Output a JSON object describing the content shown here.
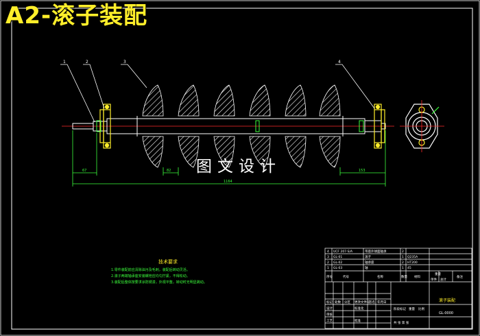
{
  "header": {
    "title": "A2-滚子装配",
    "watermark": "图文设计"
  },
  "balloons": [
    "1",
    "2",
    "3",
    "4"
  ],
  "dimensions": {
    "overall": "1164",
    "left_end": "67",
    "spacing": "82",
    "right_end": "153"
  },
  "tech_requirements": {
    "title": "技术要求",
    "items": [
      "1.零件装配前应清除油污及毛刺，装配后转动灵活。",
      "2.滚子两端轴承座安装螺栓应均匀拧紧，不得松动。",
      "3.装配后整体按要求涂防锈漆，外观平整，转动时无明显跳动。"
    ]
  },
  "parts_list": {
    "rows": [
      {
        "no": "4",
        "code": "UCF 207-S/A",
        "name": "带座外球面轴承",
        "qty": "2",
        "material": "",
        "note": ""
      },
      {
        "no": "3",
        "code": "GL-01",
        "name": "滚子",
        "qty": "1",
        "material": "Q235A",
        "note": ""
      },
      {
        "no": "2",
        "code": "GL-02",
        "name": "轴承座",
        "qty": "2",
        "material": "HT200",
        "note": ""
      },
      {
        "no": "1",
        "code": "GL-03",
        "name": "轴",
        "qty": "1",
        "material": "45",
        "note": ""
      }
    ],
    "header": {
      "no": "序号",
      "code": "代号",
      "name": "名称",
      "qty": "数量",
      "material": "材料",
      "unit_weight": "单件",
      "total_weight": "总计",
      "weight": "重量",
      "note": "备注"
    }
  },
  "title_block": {
    "drawing_name": "滚子装配",
    "drawing_number": "GL-0000",
    "revision_headers": [
      "标记",
      "处数",
      "分区",
      "更改文件号",
      "签名",
      "年月日"
    ],
    "stage_label": "阶段标记",
    "design": "设计",
    "standard": "标准化",
    "review": "审核",
    "process": "工艺",
    "approve": "批准",
    "weight_label": "重量",
    "scale_label": "比例",
    "sheet_label": "共 张 第 张"
  },
  "colors": {
    "background": "#000000",
    "frame": "#ffffff",
    "title": "#ffee2a",
    "shaft": "#ffffff",
    "centerline": "#ff2a2a",
    "bearing": "#ffee2a",
    "dimension": "#3cff3c",
    "leader": "#ffffff"
  }
}
